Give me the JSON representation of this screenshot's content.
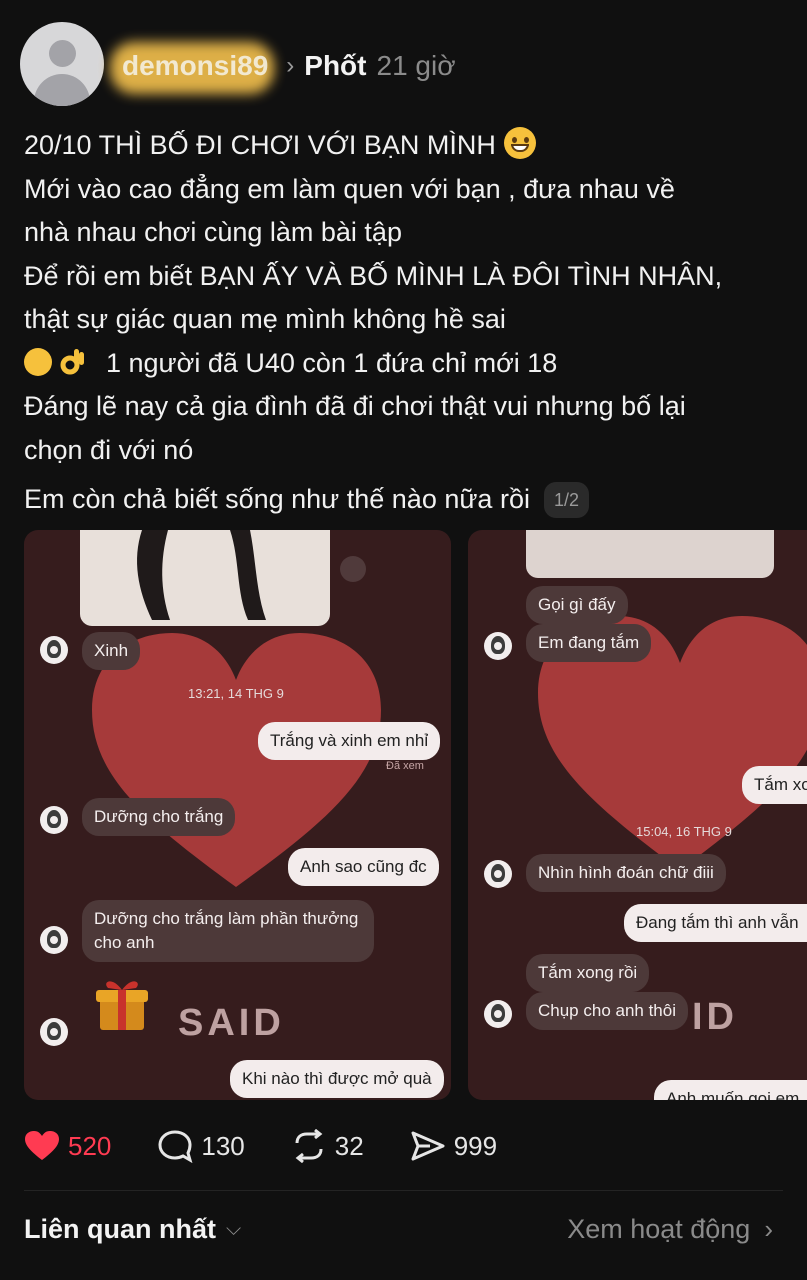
{
  "post": {
    "username": "demonsi89",
    "topic": "Phốt",
    "time": "21 giờ",
    "lines": [
      "20/10 THÌ BỐ ĐI CHƠI VỚI BẠN MÌNH",
      "Mới vào cao đẳng em làm quen với bạn , đưa nhau về",
      "nhà nhau chơi cùng làm bài tập",
      "Để rồi em biết BẠN ẤY VÀ BỐ MÌNH LÀ ĐÔI TÌNH NHÂN,",
      "thật sự giác quan mẹ mình không hề sai",
      "1 người đã U40 còn 1 đứa chỉ mới 18",
      "Đáng lẽ nay cả gia đình đã đi chơi thật vui nhưng bố lại",
      "chọn đi với nó",
      "Em còn chả biết sống như thế nào nữa rồi"
    ],
    "media_counter": "1/2"
  },
  "chat1": {
    "msg_xinh": "Xinh",
    "timestamp": "13:21, 14 THG 9",
    "msg_trang_xinh": "Trắng và xinh em nhỉ",
    "seen": "Đã xem",
    "msg_duong": "Dưỡng cho trắng",
    "msg_anh_sao": "Anh sao cũng đc",
    "msg_duong2": "Dưỡng cho trắng làm phần thưởng cho anh",
    "msg_khi_nao": "Khi nào thì được mở quà",
    "sticker_text": "SAID"
  },
  "chat2": {
    "msg_goi": "Gọi gì đấy",
    "msg_dang_tam": "Em đang tắm",
    "msg_tam_xo": "Tắm xo",
    "timestamp": "15:04, 16 THG 9",
    "msg_nhin_hinh": "Nhìn hình đoán chữ điii",
    "msg_dang_tam_anh": "Đang tắm thì anh vẫn",
    "msg_tam_xong": "Tắm xong rồi",
    "msg_chup": "Chụp cho anh thôi",
    "msg_anh_muon": "Anh muốn gọi em",
    "sticker_text": "ID"
  },
  "actions": {
    "likes": "520",
    "comments": "130",
    "reposts": "32",
    "shares": "999"
  },
  "footer": {
    "sort_label": "Liên quan nhất",
    "activity_link": "Xem hoạt động"
  },
  "colors": {
    "background": "#101010",
    "like_red": "#ff3b52",
    "chat_background": "#361c1d",
    "heart": "#a63a3a"
  }
}
